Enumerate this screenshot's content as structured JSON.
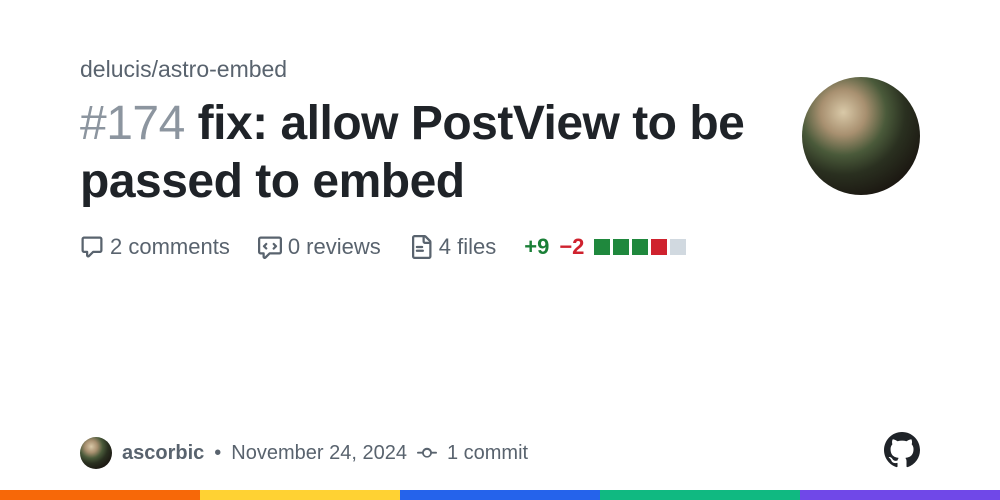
{
  "repo": "delucis/astro-embed",
  "pr_number": "#174",
  "title": "fix: allow PostView to be passed to embed",
  "stats": {
    "comments": "2 comments",
    "reviews": "0 reviews",
    "files": "4 files",
    "additions": "+9",
    "deletions": "−2"
  },
  "author": "ascorbic",
  "date": "November 24, 2024",
  "commits": "1 commit"
}
